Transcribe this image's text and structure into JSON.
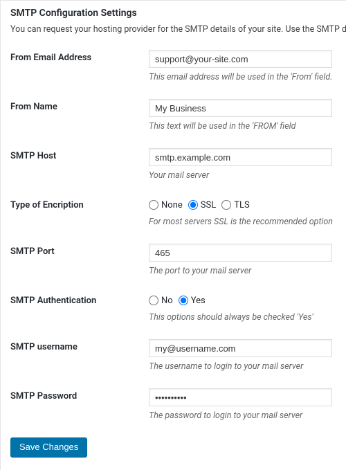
{
  "title": "SMTP Configuration Settings",
  "intro": "You can request your hosting provider for the SMTP details of your site. Use the SMTP details provided b",
  "fields": {
    "from_email": {
      "label": "From Email Address",
      "value": "support@your-site.com",
      "desc": "This email address will be used in the 'From' field."
    },
    "from_name": {
      "label": "From Name",
      "value": "My Business",
      "desc": "This text will be used in the 'FROM' field"
    },
    "smtp_host": {
      "label": "SMTP Host",
      "value": "smtp.example.com",
      "desc": "Your mail server"
    },
    "encryption": {
      "label": "Type of Encription",
      "desc": "For most servers SSL is the recommended option",
      "options": {
        "none": "None",
        "ssl": "SSL",
        "tls": "TLS"
      },
      "selected": "ssl"
    },
    "smtp_port": {
      "label": "SMTP Port",
      "value": "465",
      "desc": "The port to your mail server"
    },
    "smtp_auth": {
      "label": "SMTP Authentication",
      "desc": "This options should always be checked 'Yes'",
      "options": {
        "no": "No",
        "yes": "Yes"
      },
      "selected": "yes"
    },
    "smtp_user": {
      "label": "SMTP username",
      "value": "my@username.com",
      "desc": "The username to login to your mail server"
    },
    "smtp_pass": {
      "label": "SMTP Password",
      "value": "••••••••••",
      "desc": "The password to login to your mail server"
    }
  },
  "submit_label": "Save Changes"
}
